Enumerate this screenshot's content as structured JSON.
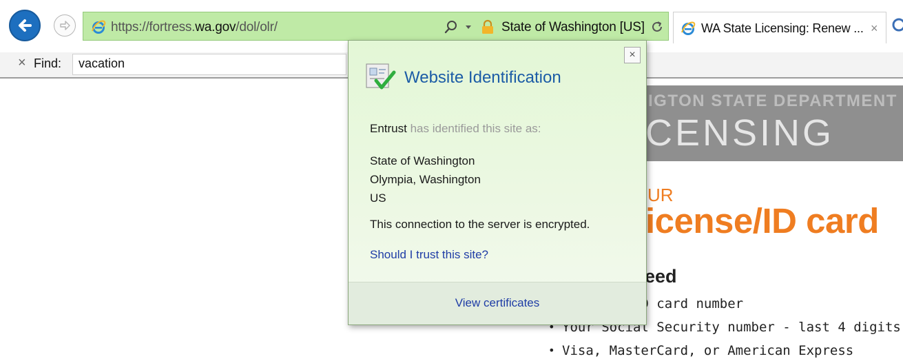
{
  "browser": {
    "address_bar": {
      "url_prefix": "https://fortress.",
      "url_domain": "wa.gov",
      "url_path": "/dol/olr/",
      "certificate_label": "State of Washington [US]",
      "background_color": "#bfeaa6"
    },
    "tab": {
      "title": "WA State Licensing: Renew ...",
      "close_label": "×"
    },
    "icons": {
      "back": "back-arrow-icon",
      "forward": "forward-arrow-icon",
      "site": "internet-explorer-icon",
      "search": "search-icon",
      "lock": "lock-icon",
      "refresh": "refresh-icon"
    }
  },
  "find_bar": {
    "close_label": "×",
    "label": "Find:",
    "query": "vacation"
  },
  "popup": {
    "title": "Website Identification",
    "close_label": "×",
    "issuer": "Entrust",
    "identity_text": "has identified this site as:",
    "organization": "State of Washington",
    "location": "Olympia, Washington",
    "country": "US",
    "encryption_note": "This connection to the server is encrypted.",
    "trust_link": "Should I trust this site?",
    "view_certificates": "View certificates"
  },
  "page": {
    "dept_line1": "IGTON STATE DEPARTMENT OF",
    "dept_line2": "CENSING",
    "renew_your": "UR",
    "heading": "icense/ID card",
    "need_heading": "eed",
    "need_items": [
      "cense or ID card number",
      "Your Social Security number - last 4 digits",
      "Visa, MasterCard, or American Express"
    ],
    "accent_color": "#ef7d21"
  }
}
